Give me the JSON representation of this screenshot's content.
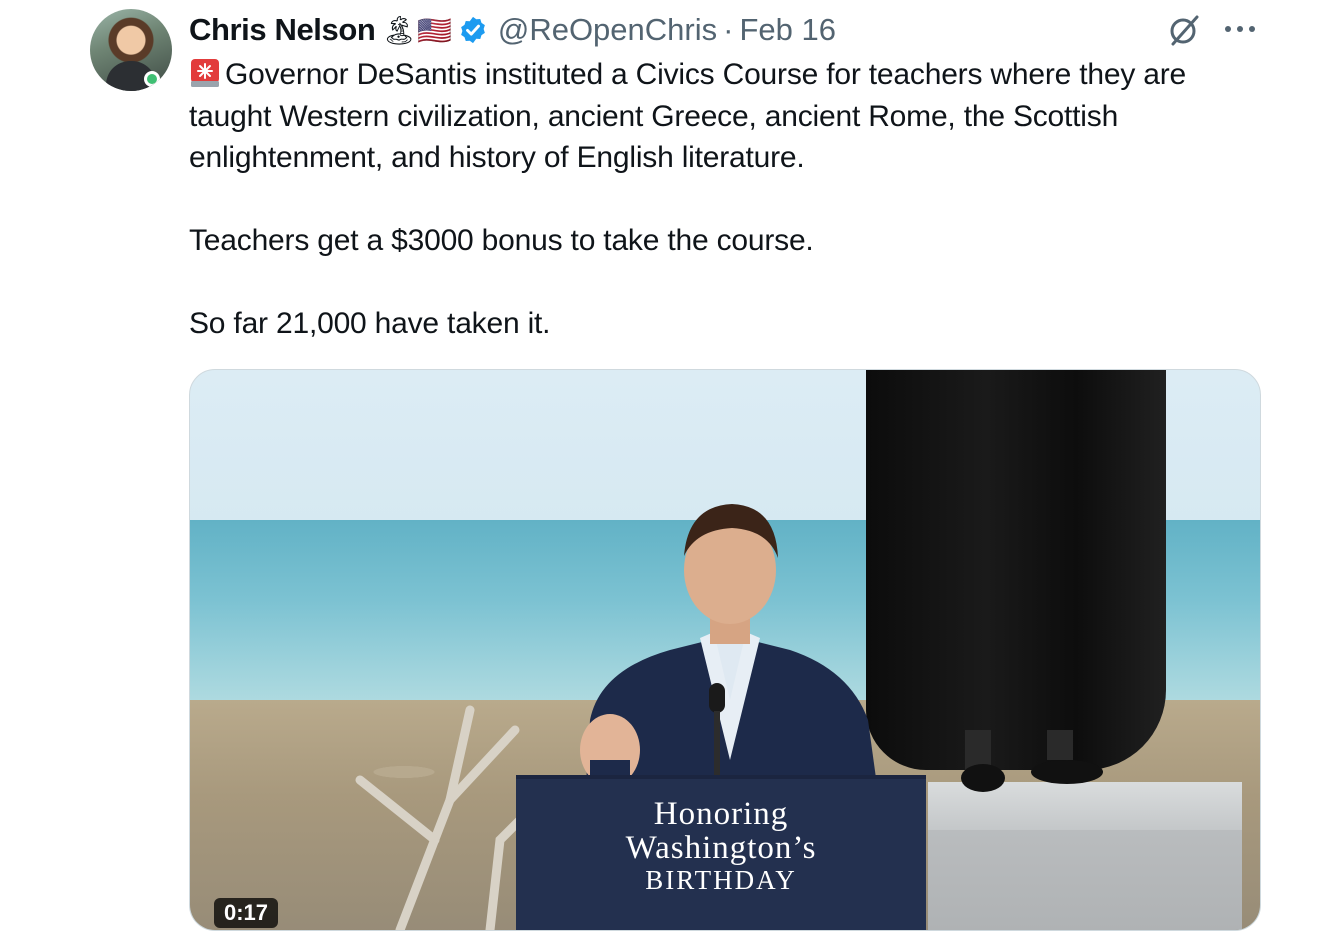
{
  "tweet": {
    "author_name": "Chris Nelson",
    "name_emoji": "🏝🇺🇸",
    "handle": "@ReOpenChris",
    "separator": "·",
    "date": "Feb 16",
    "paragraphs": [
      "Governor DeSantis instituted a Civics Course for teachers where they are taught Western civilization, ancient Greece, ancient Rome, the Scottish enlightenment, and history of English literature.",
      "Teachers get a $3000 bonus to take the course.",
      "So far 21,000 have taken it."
    ],
    "first_paragraph_icon": "siren-icon"
  },
  "media": {
    "podium_line1": "Honoring",
    "podium_line2": "Washington’s",
    "podium_line3": "BIRTHDAY",
    "video_time": "0:17"
  },
  "icons": {
    "verified": "verified-badge-icon",
    "grok": "grok-icon",
    "more": "more-options-icon"
  },
  "colors": {
    "verified_blue": "#1d9bf0",
    "secondary_text": "#536471",
    "primary_text": "#0f1419",
    "podium_navy": "#23304f"
  }
}
